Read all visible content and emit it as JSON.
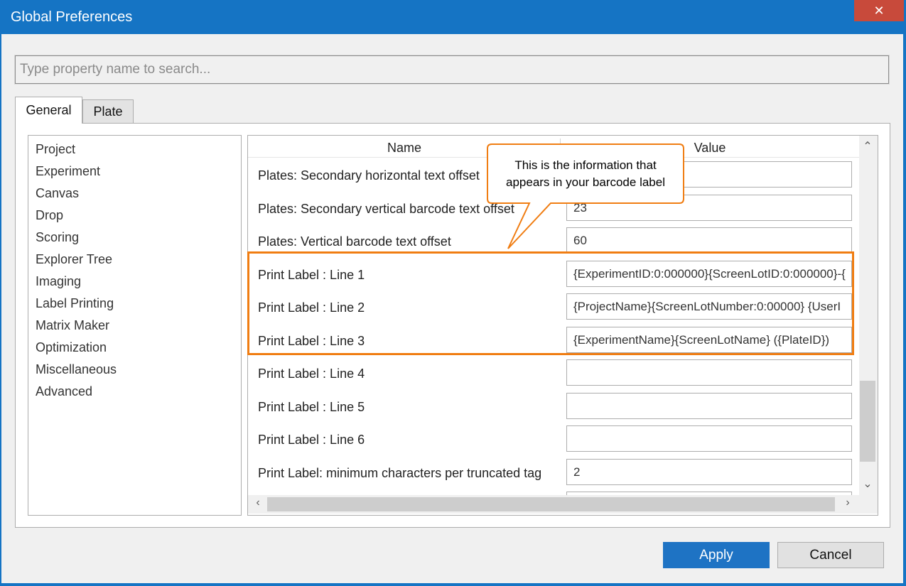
{
  "window": {
    "title": "Global Preferences",
    "close_glyph": "✕"
  },
  "search": {
    "placeholder": "Type property name to search..."
  },
  "tabs": [
    {
      "label": "General"
    },
    {
      "label": "Plate"
    }
  ],
  "nav": {
    "items": [
      "Project",
      "Experiment",
      "Canvas",
      "Drop",
      "Scoring",
      "Explorer Tree",
      "Imaging",
      "Label Printing",
      "Matrix Maker",
      "Optimization",
      "Miscellaneous",
      "Advanced"
    ],
    "selected": "Label Printing"
  },
  "grid": {
    "columns": {
      "name": "Name",
      "value": "Value"
    },
    "rows": [
      {
        "name": "Plates: Secondary horizontal text offset",
        "value": ""
      },
      {
        "name": "Plates: Secondary vertical barcode text offset",
        "value": "23"
      },
      {
        "name": "Plates: Vertical barcode text offset",
        "value": "60"
      },
      {
        "name": "Print Label : Line 1",
        "value": "{ExperimentID:0:000000}{ScreenLotID:0:000000}-{"
      },
      {
        "name": "Print Label : Line 2",
        "value": "{ProjectName}{ScreenLotNumber:0:00000}  {UserI"
      },
      {
        "name": "Print Label : Line 3",
        "value": "{ExperimentName}{ScreenLotName}  ({PlateID})"
      },
      {
        "name": "Print Label : Line 4",
        "value": ""
      },
      {
        "name": "Print Label : Line 5",
        "value": ""
      },
      {
        "name": "Print Label : Line 6",
        "value": ""
      },
      {
        "name": "Print Label: minimum characters per truncated tag",
        "value": "2"
      }
    ]
  },
  "callout": {
    "line1": "This is the information that",
    "line2": "appears in your barcode label"
  },
  "buttons": {
    "apply": "Apply",
    "cancel": "Cancel"
  },
  "colors": {
    "accent": "#1574c4",
    "highlight": "#f07d12",
    "close": "#c84a3b"
  }
}
